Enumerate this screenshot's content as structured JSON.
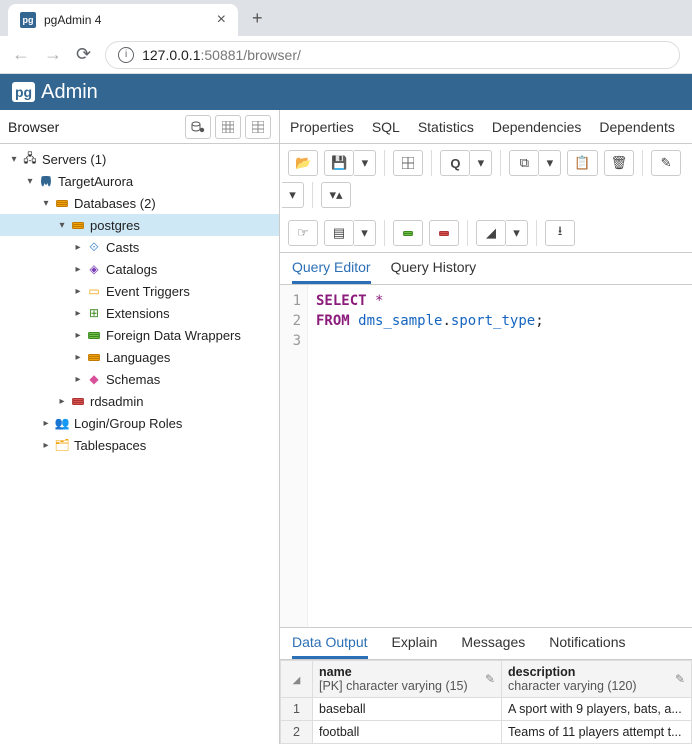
{
  "chrome": {
    "tab_title": "pgAdmin 4",
    "url_host": "127.0.0.1",
    "url_port_path": ":50881/browser/"
  },
  "pg_logo": {
    "box": "pg",
    "text": "Admin"
  },
  "browser_panel": {
    "title": "Browser"
  },
  "tree": {
    "servers": "Servers (1)",
    "target": "TargetAurora",
    "databases": "Databases (2)",
    "postgres": "postgres",
    "casts": "Casts",
    "catalogs": "Catalogs",
    "event_triggers": "Event Triggers",
    "extensions": "Extensions",
    "fdw": "Foreign Data Wrappers",
    "languages": "Languages",
    "schemas": "Schemas",
    "rdsadmin": "rdsadmin",
    "login_roles": "Login/Group Roles",
    "tablespaces": "Tablespaces"
  },
  "prop_tabs": {
    "properties": "Properties",
    "sql": "SQL",
    "statistics": "Statistics",
    "dependencies": "Dependencies",
    "dependents": "Dependents"
  },
  "editor_tabs": {
    "query_editor": "Query Editor",
    "query_history": "Query History"
  },
  "sql": {
    "line1_kw": "SELECT",
    "line1_rest": " *",
    "line2_kw": "FROM",
    "line2_schema": "dms_sample",
    "line2_table": "sport_type",
    "lines": [
      "1",
      "2",
      "3"
    ]
  },
  "output_tabs": {
    "data_output": "Data Output",
    "explain": "Explain",
    "messages": "Messages",
    "notifications": "Notifications"
  },
  "grid": {
    "columns": [
      {
        "name": "name",
        "type": "[PK] character varying (15)"
      },
      {
        "name": "description",
        "type": "character varying (120)"
      }
    ],
    "rows": [
      {
        "n": "1",
        "name": "baseball",
        "description": "A sport with 9 players, bats, a..."
      },
      {
        "n": "2",
        "name": "football",
        "description": "Teams of 11 players attempt t..."
      }
    ]
  }
}
